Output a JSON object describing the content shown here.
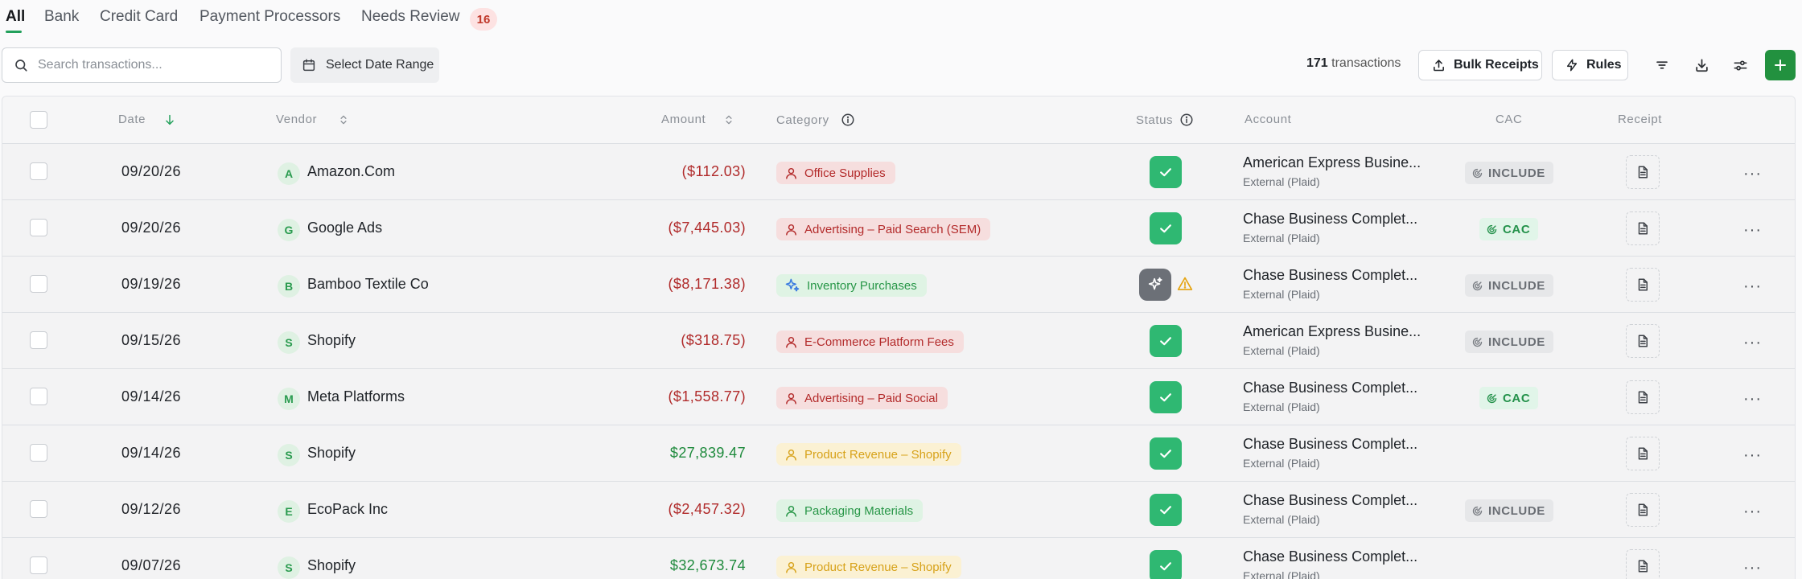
{
  "tabs": [
    {
      "label": "All"
    },
    {
      "label": "Bank"
    },
    {
      "label": "Credit Card"
    },
    {
      "label": "Payment Processors"
    },
    {
      "label": "Needs Review"
    }
  ],
  "needs_review_count": "16",
  "search": {
    "placeholder": "Search transactions..."
  },
  "date_range_label": "Select Date Range",
  "transactions_count": "171",
  "transactions_word": "transactions",
  "bulk_receipts_label": "Bulk Receipts",
  "rules_label": "Rules",
  "columns": {
    "date": "Date",
    "vendor": "Vendor",
    "amount": "Amount",
    "category": "Category",
    "status": "Status",
    "account": "Account",
    "cac": "CAC",
    "receipt": "Receipt"
  },
  "colors": {
    "accent": "#22a05b",
    "negative": "#b02a2a",
    "positive": "#1e8a3c",
    "status_ok": "#2fb872"
  },
  "rows": [
    {
      "date": "09/20/26",
      "initial": "A",
      "vendor": "Amazon.Com",
      "amount": "($112.03)",
      "sign": "neg",
      "category": "Office Supplies",
      "cat_style": "red",
      "cat_icon": "user-icon",
      "status": "ok",
      "account": "American Express Busine...",
      "source": "External (Plaid)",
      "cac": "INCLUDE"
    },
    {
      "date": "09/20/26",
      "initial": "G",
      "vendor": "Google Ads",
      "amount": "($7,445.03)",
      "sign": "neg",
      "category": "Advertising – Paid Search (SEM)",
      "cat_style": "red",
      "cat_icon": "user-icon",
      "status": "ok",
      "account": "Chase Business Complet...",
      "source": "External (Plaid)",
      "cac": "CAC"
    },
    {
      "date": "09/19/26",
      "initial": "B",
      "vendor": "Bamboo Textile Co",
      "amount": "($8,171.38)",
      "sign": "neg",
      "category": "Inventory Purchases",
      "cat_style": "green",
      "cat_icon": "sparkle-icon",
      "status": "ai-warning",
      "account": "Chase Business Complet...",
      "source": "External (Plaid)",
      "cac": "INCLUDE"
    },
    {
      "date": "09/15/26",
      "initial": "S",
      "vendor": "Shopify",
      "amount": "($318.75)",
      "sign": "neg",
      "category": "E-Commerce Platform Fees",
      "cat_style": "red",
      "cat_icon": "user-icon",
      "status": "ok",
      "account": "American Express Busine...",
      "source": "External (Plaid)",
      "cac": "INCLUDE"
    },
    {
      "date": "09/14/26",
      "initial": "M",
      "vendor": "Meta Platforms",
      "amount": "($1,558.77)",
      "sign": "neg",
      "category": "Advertising – Paid Social",
      "cat_style": "red",
      "cat_icon": "user-icon",
      "status": "ok",
      "account": "Chase Business Complet...",
      "source": "External (Plaid)",
      "cac": "CAC"
    },
    {
      "date": "09/14/26",
      "initial": "S",
      "vendor": "Shopify",
      "amount": "$27,839.47",
      "sign": "pos",
      "category": "Product Revenue – Shopify",
      "cat_style": "yellow",
      "cat_icon": "user-icon",
      "status": "ok",
      "account": "Chase Business Complet...",
      "source": "External (Plaid)",
      "cac": ""
    },
    {
      "date": "09/12/26",
      "initial": "E",
      "vendor": "EcoPack Inc",
      "amount": "($2,457.32)",
      "sign": "neg",
      "category": "Packaging Materials",
      "cat_style": "green",
      "cat_icon": "user-icon",
      "status": "ok",
      "account": "Chase Business Complet...",
      "source": "External (Plaid)",
      "cac": "INCLUDE"
    },
    {
      "date": "09/07/26",
      "initial": "S",
      "vendor": "Shopify",
      "amount": "$32,673.74",
      "sign": "pos",
      "category": "Product Revenue – Shopify",
      "cat_style": "yellow",
      "cat_icon": "user-icon",
      "status": "ok",
      "account": "Chase Business Complet...",
      "source": "External (Plaid)",
      "cac": ""
    }
  ]
}
